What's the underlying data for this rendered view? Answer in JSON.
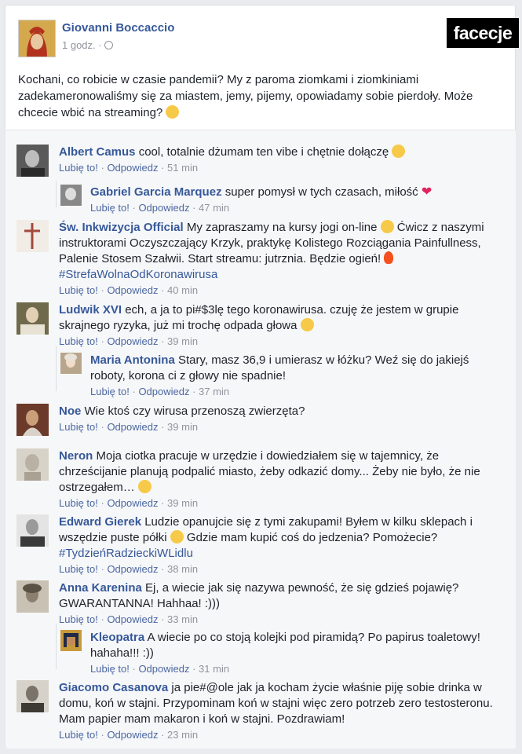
{
  "post": {
    "author": "Giovanni Boccaccio",
    "time": "1 godz. · ",
    "globe_icon": "globe-icon",
    "text": "Kochani, co robicie w czasie pandemii? My z paroma ziomkami i ziomkiniami zadekameronowaliśmy się za miastem, jemy, pijemy, opowiadamy sobie pierdoły. Może chcecie wbić na streaming?"
  },
  "logo": "facecje",
  "actions": {
    "like": "Lubię to!",
    "reply": "Odpowiedz",
    "sep": " · "
  },
  "comments": [
    {
      "name": "Albert Camus",
      "text": "cool, totalnie dżumam ten vibe i chętnie dołączę",
      "time": "51 min"
    },
    {
      "name": "Gabriel Garcia Marquez",
      "text": "super pomysł w tych czasach, miłość",
      "time": "47 min"
    },
    {
      "name": "Św. Inkwizycja Official",
      "text": "My zapraszamy na kursy jogi on-line",
      "text2": "Ćwicz z naszymi instruktorami Oczyszczający Krzyk, praktykę Kolistego Rozciągania Painfullness, Palenie Stosem Szałwii. Start streamu: jutrznia. Będzie ogień!",
      "tag": "#StrefaWolnaOdKoronawirusa",
      "time": "40 min"
    },
    {
      "name": "Ludwik XVI",
      "text": "ech, a ja to pi#$3lę tego koronawirusa. czuję że jestem w grupie skrajnego ryzyka, już mi trochę odpada głowa",
      "time": "39 min"
    },
    {
      "name": "Maria Antonina",
      "text": "Stary, masz 36,9 i umierasz w łóżku? Weź się do jakiejś roboty, korona ci z głowy nie spadnie!",
      "time": "37 min"
    },
    {
      "name": "Noe",
      "text": "Wie ktoś czy wirusa przenoszą zwierzęta?",
      "time": "39 min"
    },
    {
      "name": "Neron",
      "text": "Moja ciotka pracuje w urzędzie i dowiedziałem się w tajemnicy, że chrześcijanie planują podpalić miasto, żeby odkazić domy... Żeby nie było, że nie ostrzegałem…",
      "time": "39 min"
    },
    {
      "name": "Edward Gierek",
      "text": "Ludzie opanujcie się z tymi zakupami! Byłem w kilku sklepach i wszędzie puste półki",
      "text2": "Gdzie mam kupić coś do jedzenia? Pomożecie?",
      "tag": "#TydzieńRadzieckiWLidlu",
      "time": "38 min"
    },
    {
      "name": "Anna Karenina",
      "text": "Ej, a wiecie jak się nazywa pewność, że się gdzieś pojawię? GWARANTANNA! Hahhaa! :)))",
      "time": "33 min"
    },
    {
      "name": "Kleopatra",
      "text": "A wiecie po co stoją kolejki pod piramidą? Po papirus toaletowy! hahaha!!! :))",
      "time": "31 min"
    },
    {
      "name": "Giacomo Casanova",
      "text": "ja pie#@ole jak ja kocham życie właśnie piję sobie drinka w domu, koń w stajni. Przypominam koń w stajni więc zero potrzeb zero testosteronu. Mam papier mam makaron i koń w stajni. Pozdrawiam!",
      "time": "23 min"
    }
  ],
  "colors": {
    "name": "#365899",
    "meta": "#90949c",
    "text": "#1d2129",
    "bg": "#e9ebee",
    "comments_bg": "#f6f7f9"
  }
}
